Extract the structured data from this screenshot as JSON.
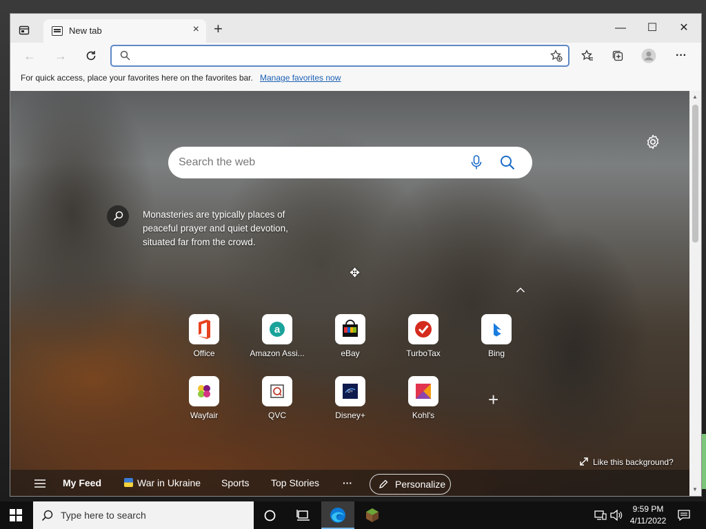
{
  "window": {
    "tab_title": "New tab",
    "tab_close": "×",
    "new_tab": "+",
    "minimize": "—",
    "maximize": "☐",
    "close": "✕"
  },
  "toolbar": {
    "back": "←",
    "forward": "→",
    "address_value": "",
    "more": "···"
  },
  "favorites_bar": {
    "message": "For quick access, place your favorites here on the favorites bar.",
    "link": "Manage favorites now"
  },
  "newtab": {
    "search_placeholder": "Search the web",
    "fact": "Monasteries are typically places of peaceful prayer and quiet devotion, situated far from the crowd.",
    "like_background": "Like this background?",
    "add_site": "+",
    "tiles": [
      {
        "label": "Office",
        "icon": "office-icon"
      },
      {
        "label": "Amazon Assi...",
        "icon": "amazon-assistant-icon"
      },
      {
        "label": "eBay",
        "icon": "ebay-icon"
      },
      {
        "label": "TurboTax",
        "icon": "turbotax-icon"
      },
      {
        "label": "Bing",
        "icon": "bing-icon"
      },
      {
        "label": "Wayfair",
        "icon": "wayfair-icon"
      },
      {
        "label": "QVC",
        "icon": "qvc-icon"
      },
      {
        "label": "Disney+",
        "icon": "disney-plus-icon"
      },
      {
        "label": "Kohl's",
        "icon": "kohls-icon"
      }
    ]
  },
  "feed": {
    "my_feed": "My Feed",
    "war": "War in Ukraine",
    "sports": "Sports",
    "top_stories": "Top Stories",
    "more": "···",
    "personalize": "Personalize"
  },
  "taskbar": {
    "search_placeholder": "Type here to search",
    "time": "9:59 PM",
    "date": "4/11/2022"
  },
  "colors": {
    "accent": "#1a5fb4",
    "taskbar": "#101010",
    "edge_blue": "#0c7bd8"
  }
}
